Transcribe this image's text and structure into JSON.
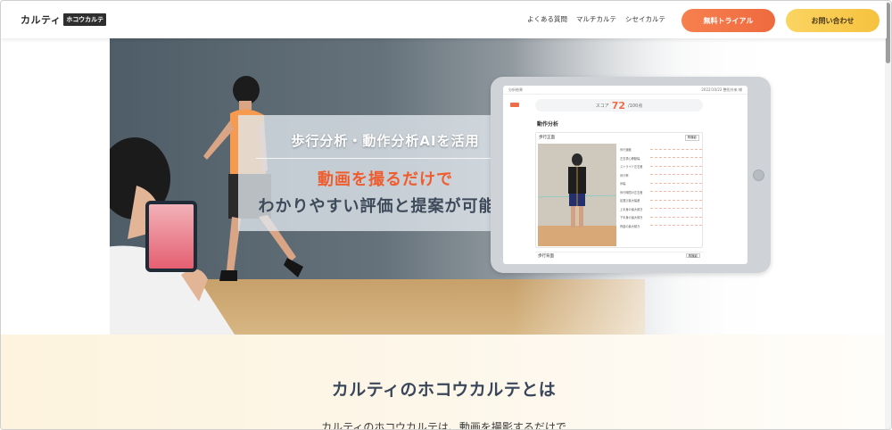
{
  "header": {
    "logo_text": "カルティ",
    "logo_badge": "ホコウカルテ",
    "nav": [
      "よくある質問",
      "マルチカルテ",
      "シセイカルテ"
    ],
    "trial_button": "無料トライアル",
    "contact_button": "お問い合わせ"
  },
  "hero": {
    "line1": "歩行分析・動作分析AIを活用",
    "line2": "動画を撮るだけで",
    "line3": "わかりやすい評価と提案が可能に",
    "tablet": {
      "back_label": "分析結果",
      "date": "2022/10/22  整形外来 様",
      "score_label": "スコア",
      "score_value": "72",
      "score_max": "/100点",
      "section_title": "動作分析",
      "panel_title": "歩行正面",
      "panel_button": "再撮影",
      "rows": [
        "歩行速度",
        "左右重心移動幅",
        "ストライド左右差",
        "歩行率",
        "歩幅",
        "歩行時間の左右差",
        "足運び最大幅差",
        "上半身の最大傾き",
        "下半身の最大傾き",
        "骨盤の最大傾き"
      ],
      "footer_title": "歩行背面",
      "footer_button": "再撮影"
    }
  },
  "about": {
    "title": "カルティのホコウカルテとは",
    "text": "カルティのホコウカルテは、動画を撮影するだけで"
  },
  "colors": {
    "accent_orange": "#ef5d2f",
    "cta_yellow": "#f6c23f",
    "heading_navy": "#3a475a"
  }
}
